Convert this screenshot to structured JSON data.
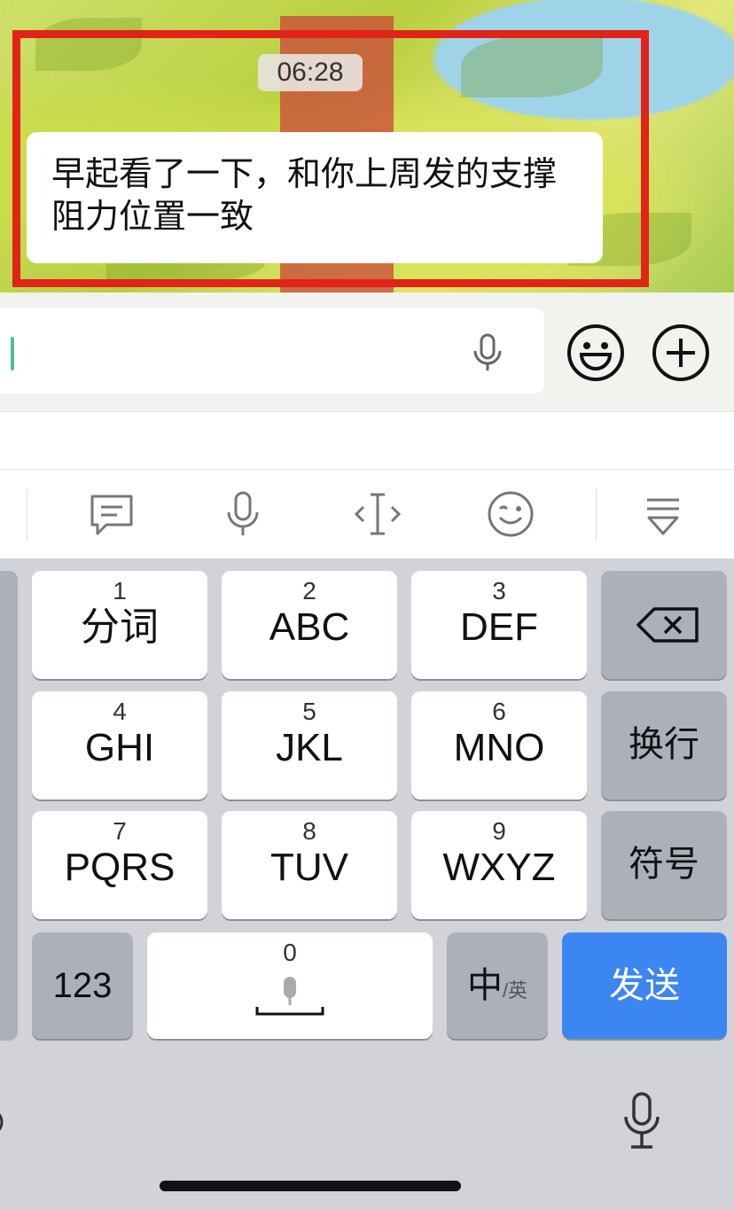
{
  "chat": {
    "timestamp": "06:28",
    "message": "早起看了一下，和你上周发的支撑阻力位置一致",
    "highlight_color": "#e2231a"
  },
  "input": {
    "value": "",
    "caret_color": "#4fc08d"
  },
  "toolbar": {
    "icons": [
      "chat-bubble-icon",
      "microphone-icon",
      "cursor-move-icon",
      "emoji-wink-icon",
      "collapse-keyboard-icon"
    ]
  },
  "keyboard": {
    "rows": [
      [
        {
          "num": "1",
          "label": "分词"
        },
        {
          "num": "2",
          "label": "ABC"
        },
        {
          "num": "3",
          "label": "DEF"
        }
      ],
      [
        {
          "num": "4",
          "label": "GHI"
        },
        {
          "num": "5",
          "label": "JKL"
        },
        {
          "num": "6",
          "label": "MNO"
        }
      ],
      [
        {
          "num": "7",
          "label": "PQRS"
        },
        {
          "num": "8",
          "label": "TUV"
        },
        {
          "num": "9",
          "label": "WXYZ"
        }
      ]
    ],
    "side": {
      "delete": "backspace-icon",
      "newline": "换行",
      "symbols": "符号"
    },
    "bottom": {
      "numbers": "123",
      "space_num": "0",
      "lang_main": "中",
      "lang_sub": "/英",
      "send": "发送"
    },
    "send_color": "#3b86f0"
  }
}
